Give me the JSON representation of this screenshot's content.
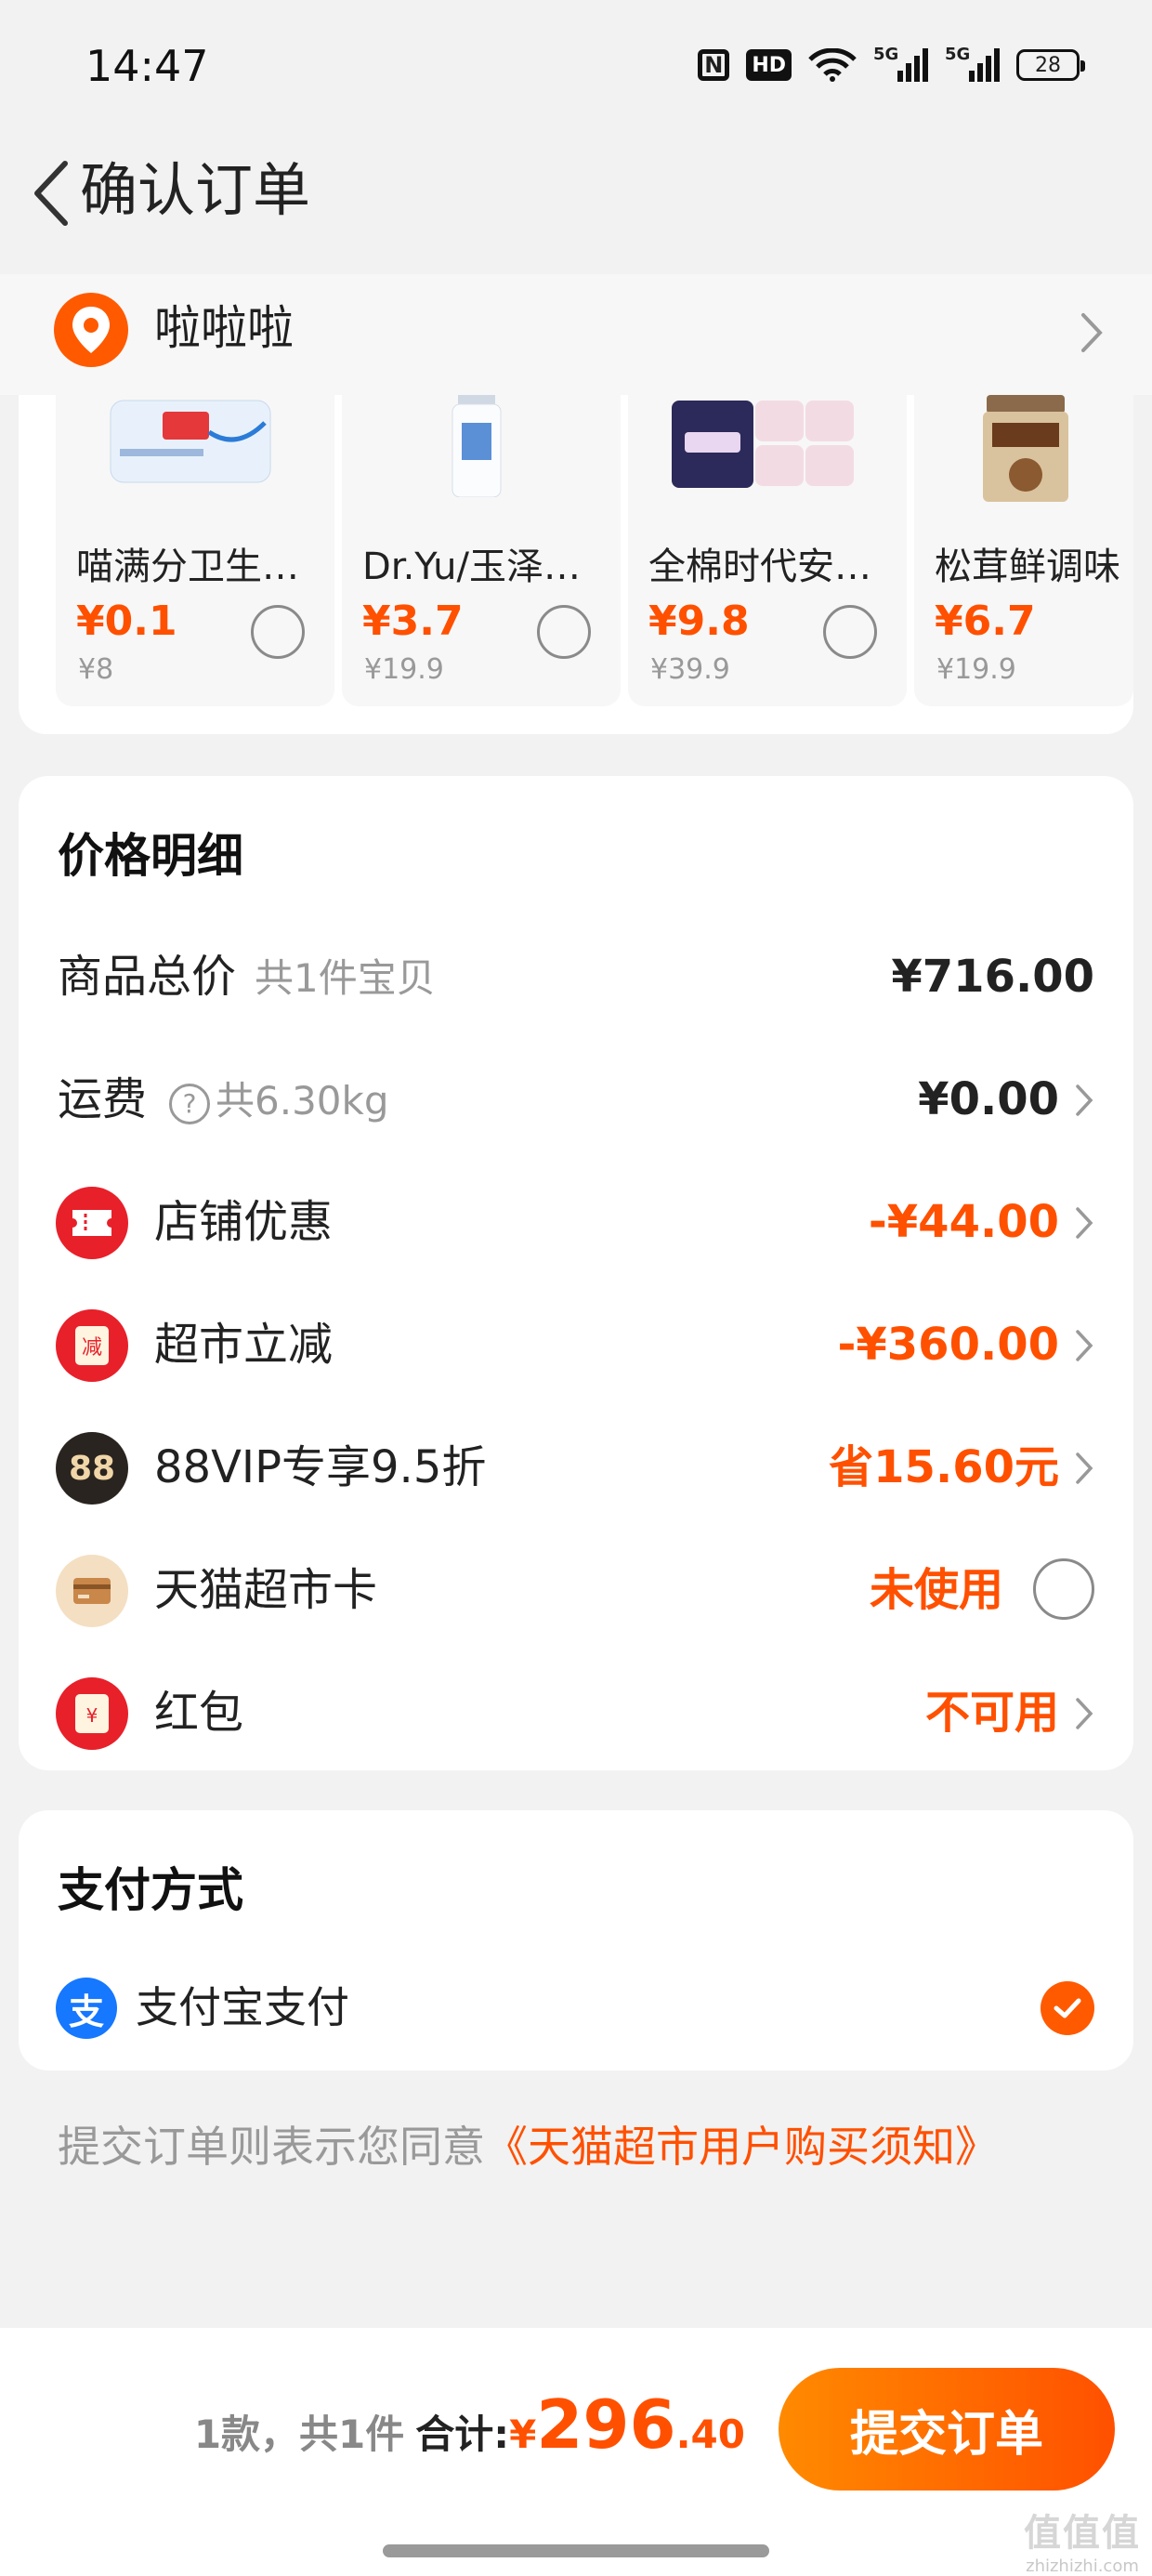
{
  "status_bar": {
    "time": "14:47",
    "hd_label": "HD",
    "net1": "5G",
    "net2": "5G",
    "battery": "28"
  },
  "nav": {
    "title": "确认订单",
    "back_icon": "chevron-left-icon"
  },
  "address": {
    "name": "啦啦啦",
    "icon": "location-pin-icon"
  },
  "products": [
    {
      "name": "喵满分卫生除…",
      "price": "¥0.1",
      "original_price": "¥8",
      "selected": false
    },
    {
      "name": "Dr.Yu/玉泽洁面",
      "price": "¥3.7",
      "original_price": "¥19.9",
      "selected": false
    },
    {
      "name": "全棉时代安睡…",
      "price": "¥9.8",
      "original_price": "¥39.9",
      "selected": false
    },
    {
      "name": "松茸鲜调味",
      "price": "¥6.7",
      "original_price": "¥19.9",
      "selected": false
    }
  ],
  "price_detail": {
    "title": "价格明细",
    "goods_total": {
      "label": "商品总价",
      "sub": "共1件宝贝",
      "value": "¥716.00"
    },
    "shipping": {
      "label": "运费",
      "sub": "共6.30kg",
      "value": "¥0.00"
    },
    "store_discount": {
      "label": "店铺优惠",
      "value": "-¥44.00"
    },
    "market_reduction": {
      "label": "超市立减",
      "value": "-¥360.00"
    },
    "vip": {
      "label": "88VIP专享9.5折",
      "value": "省15.60元",
      "badge": "88"
    },
    "market_card": {
      "label": "天猫超市卡",
      "value": "未使用"
    },
    "red_packet": {
      "label": "红包",
      "value": "不可用"
    }
  },
  "payment": {
    "title": "支付方式",
    "method": "支付宝支付",
    "icon_char": "支"
  },
  "agreement": {
    "text": "提交订单则表示您同意",
    "link": "《天猫超市用户购买须知》"
  },
  "bottom": {
    "count": "1款，共1件",
    "total_label": "合计:",
    "currency": "¥",
    "total_int": "296",
    "total_dec": ".40",
    "submit_label": "提交订单"
  },
  "watermark": {
    "big": "值值值",
    "small": "zhizhizhi.com"
  },
  "colors": {
    "accent": "#ff5000",
    "gradient_start": "#ff8a00",
    "alipay_blue": "#1677ff",
    "background": "#f2f2f2"
  }
}
